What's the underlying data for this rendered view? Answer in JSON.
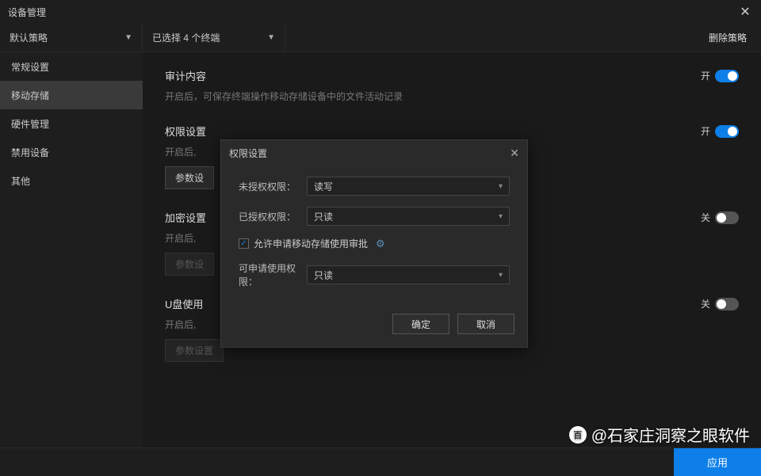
{
  "titlebar": {
    "title": "设备管理"
  },
  "toolbar": {
    "policy_dropdown": "默认策略",
    "terminal_dropdown": "已选择 4 个终端",
    "delete_policy": "删除策略"
  },
  "sidebar": {
    "items": [
      {
        "label": "常规设置"
      },
      {
        "label": "移动存储"
      },
      {
        "label": "硬件管理"
      },
      {
        "label": "禁用设备"
      },
      {
        "label": "其他"
      }
    ],
    "active_index": 1
  },
  "sections": [
    {
      "title": "审计内容",
      "desc": "开启后，可保存终端操作移动存储设备中的文件活动记录",
      "toggle_label": "开",
      "toggle_on": true,
      "has_param": false
    },
    {
      "title": "权限设置",
      "desc": "开启后,",
      "toggle_label": "开",
      "toggle_on": true,
      "has_param": true,
      "param_label": "参数设",
      "param_disabled": false
    },
    {
      "title": "加密设置",
      "desc": "开启后,",
      "toggle_label": "关",
      "toggle_on": false,
      "has_param": true,
      "param_label": "参数设",
      "param_disabled": true
    },
    {
      "title": "U盘使用",
      "desc": "开启后,",
      "toggle_label": "关",
      "toggle_on": false,
      "has_param": true,
      "param_label": "参数设置",
      "param_disabled": true
    }
  ],
  "modal": {
    "title": "权限设置",
    "fields": {
      "unauth_label": "未授权权限：",
      "unauth_value": "读写",
      "auth_label": "已授权权限：",
      "auth_value": "只读",
      "checkbox_label": "允许申请移动存储使用审批",
      "checkbox_checked": true,
      "applicable_label": "可申请使用权限：",
      "applicable_value": "只读"
    },
    "ok": "确定",
    "cancel": "取消"
  },
  "bottom": {
    "apply": "应用"
  },
  "watermark": {
    "logo_text": "百",
    "text": "@石家庄洞察之眼软件"
  }
}
